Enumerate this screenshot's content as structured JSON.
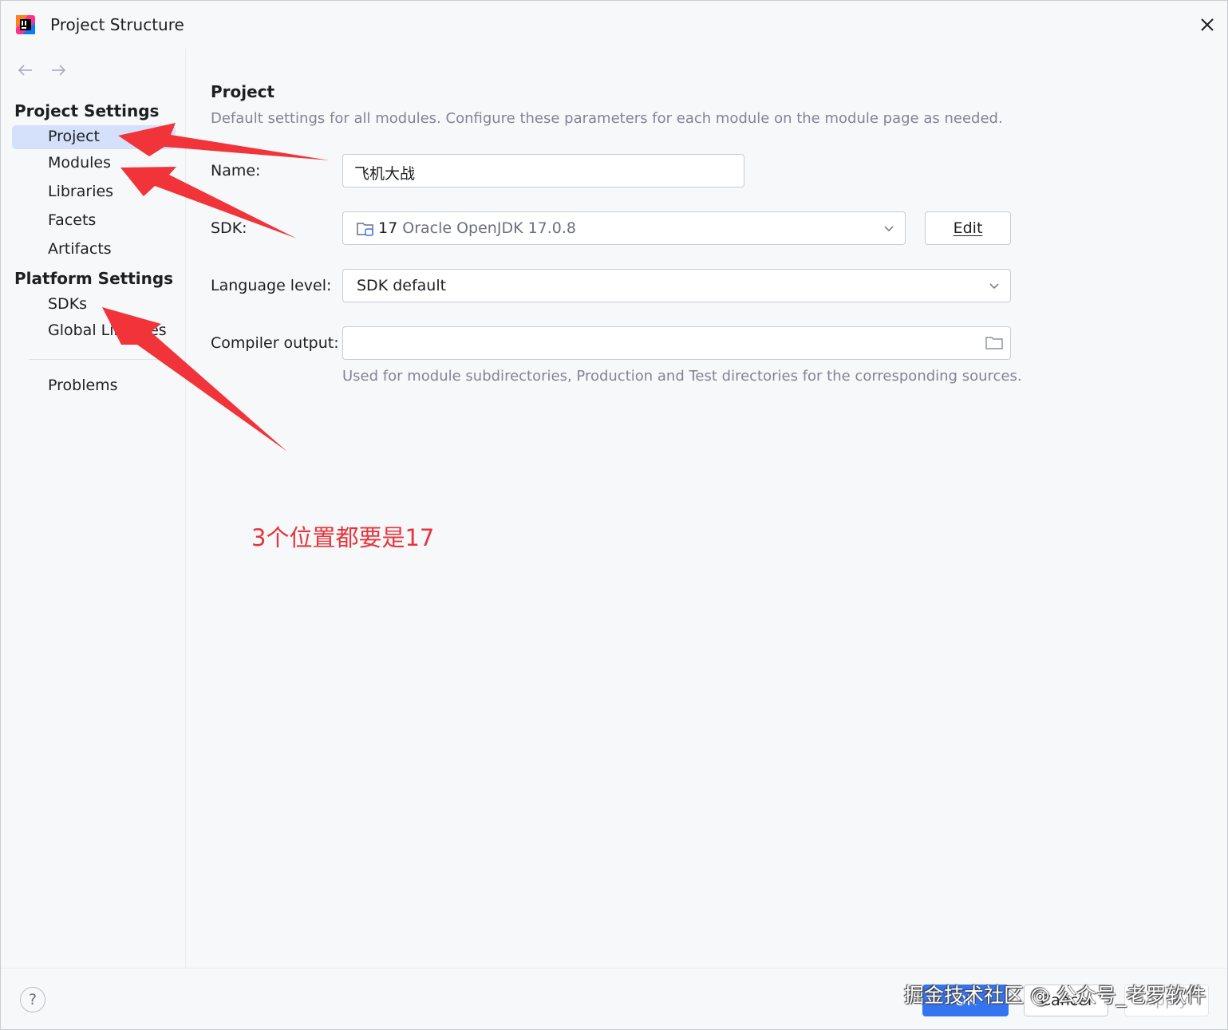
{
  "window": {
    "title": "Project Structure",
    "app_icon": "intellij-idea-icon",
    "close_icon": "close-icon"
  },
  "sidebar": {
    "nav": {
      "back_icon": "arrow-left-icon",
      "forward_icon": "arrow-right-icon"
    },
    "sections": [
      {
        "header": "Project Settings",
        "items": [
          {
            "label": "Project",
            "selected": true
          },
          {
            "label": "Modules",
            "selected": false
          },
          {
            "label": "Libraries",
            "selected": false
          },
          {
            "label": "Facets",
            "selected": false
          },
          {
            "label": "Artifacts",
            "selected": false
          }
        ]
      },
      {
        "header": "Platform Settings",
        "items": [
          {
            "label": "SDKs",
            "selected": false
          },
          {
            "label": "Global Libraries",
            "selected": false
          }
        ]
      }
    ],
    "extra_items": [
      {
        "label": "Problems"
      }
    ]
  },
  "main": {
    "title": "Project",
    "description": "Default settings for all modules. Configure these parameters for each module on the module page as needed.",
    "fields": {
      "name": {
        "label": "Name:",
        "value": "飞机大战"
      },
      "sdk": {
        "label": "SDK:",
        "version": "17",
        "detail": "Oracle OpenJDK 17.0.8",
        "icon": "folder-sdk-icon",
        "edit_label": "Edit"
      },
      "language_level": {
        "label": "Language level:",
        "value": "SDK default"
      },
      "compiler_output": {
        "label": "Compiler output:",
        "value": "",
        "browse_icon": "folder-icon",
        "hint": "Used for module subdirectories, Production and Test directories for the corresponding sources."
      }
    }
  },
  "annotation": {
    "text": "3个位置都要是17",
    "color": "#e8343a"
  },
  "footer": {
    "help_label": "?",
    "ok_label": "OK",
    "cancel_label": "Cancel",
    "apply_label": "Apply",
    "watermark": "掘金技术社区 @ 公众号_老罗软件"
  },
  "colors": {
    "accent": "#3574f0",
    "selection": "#d5e1fb",
    "background": "#f7f8fa",
    "muted_text": "#818594",
    "arrow": "#f0343a"
  }
}
